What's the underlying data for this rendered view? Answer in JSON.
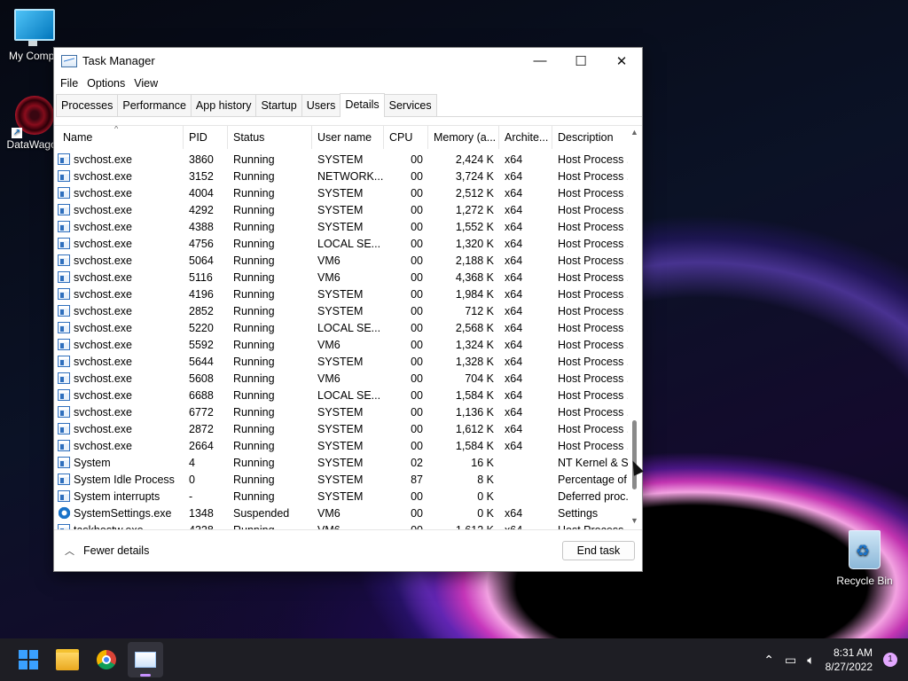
{
  "desktop": {
    "icons": [
      {
        "label": "My Compu",
        "icon": "monitor-icon"
      },
      {
        "label": "DataWagon",
        "icon": "datawagon-shortcut-icon"
      },
      {
        "label": "Recycle Bin",
        "icon": "recycle-bin-icon"
      }
    ]
  },
  "window": {
    "title": "Task Manager",
    "controls": {
      "minimize": "—",
      "maximize": "☐",
      "close": "✕"
    },
    "menu": [
      "File",
      "Options",
      "View"
    ],
    "tabs": [
      "Processes",
      "Performance",
      "App history",
      "Startup",
      "Users",
      "Details",
      "Services"
    ],
    "active_tab": "Details",
    "columns": [
      "Name",
      "PID",
      "Status",
      "User name",
      "CPU",
      "Memory (a...",
      "Archite...",
      "Description"
    ],
    "rows": [
      {
        "name": "svchost.exe",
        "pid": "3860",
        "status": "Running",
        "user": "SYSTEM",
        "cpu": "00",
        "mem": "2,424 K",
        "arch": "x64",
        "desc": "Host Process ...",
        "icon": "process"
      },
      {
        "name": "svchost.exe",
        "pid": "3152",
        "status": "Running",
        "user": "NETWORK...",
        "cpu": "00",
        "mem": "3,724 K",
        "arch": "x64",
        "desc": "Host Process ...",
        "icon": "process"
      },
      {
        "name": "svchost.exe",
        "pid": "4004",
        "status": "Running",
        "user": "SYSTEM",
        "cpu": "00",
        "mem": "2,512 K",
        "arch": "x64",
        "desc": "Host Process ...",
        "icon": "process"
      },
      {
        "name": "svchost.exe",
        "pid": "4292",
        "status": "Running",
        "user": "SYSTEM",
        "cpu": "00",
        "mem": "1,272 K",
        "arch": "x64",
        "desc": "Host Process ...",
        "icon": "process"
      },
      {
        "name": "svchost.exe",
        "pid": "4388",
        "status": "Running",
        "user": "SYSTEM",
        "cpu": "00",
        "mem": "1,552 K",
        "arch": "x64",
        "desc": "Host Process ...",
        "icon": "process"
      },
      {
        "name": "svchost.exe",
        "pid": "4756",
        "status": "Running",
        "user": "LOCAL SE...",
        "cpu": "00",
        "mem": "1,320 K",
        "arch": "x64",
        "desc": "Host Process ...",
        "icon": "process"
      },
      {
        "name": "svchost.exe",
        "pid": "5064",
        "status": "Running",
        "user": "VM6",
        "cpu": "00",
        "mem": "2,188 K",
        "arch": "x64",
        "desc": "Host Process ...",
        "icon": "process"
      },
      {
        "name": "svchost.exe",
        "pid": "5116",
        "status": "Running",
        "user": "VM6",
        "cpu": "00",
        "mem": "4,368 K",
        "arch": "x64",
        "desc": "Host Process ...",
        "icon": "process"
      },
      {
        "name": "svchost.exe",
        "pid": "4196",
        "status": "Running",
        "user": "SYSTEM",
        "cpu": "00",
        "mem": "1,984 K",
        "arch": "x64",
        "desc": "Host Process ...",
        "icon": "process"
      },
      {
        "name": "svchost.exe",
        "pid": "2852",
        "status": "Running",
        "user": "SYSTEM",
        "cpu": "00",
        "mem": "712 K",
        "arch": "x64",
        "desc": "Host Process ...",
        "icon": "process"
      },
      {
        "name": "svchost.exe",
        "pid": "5220",
        "status": "Running",
        "user": "LOCAL SE...",
        "cpu": "00",
        "mem": "2,568 K",
        "arch": "x64",
        "desc": "Host Process ...",
        "icon": "process"
      },
      {
        "name": "svchost.exe",
        "pid": "5592",
        "status": "Running",
        "user": "VM6",
        "cpu": "00",
        "mem": "1,324 K",
        "arch": "x64",
        "desc": "Host Process ...",
        "icon": "process"
      },
      {
        "name": "svchost.exe",
        "pid": "5644",
        "status": "Running",
        "user": "SYSTEM",
        "cpu": "00",
        "mem": "1,328 K",
        "arch": "x64",
        "desc": "Host Process ...",
        "icon": "process"
      },
      {
        "name": "svchost.exe",
        "pid": "5608",
        "status": "Running",
        "user": "VM6",
        "cpu": "00",
        "mem": "704 K",
        "arch": "x64",
        "desc": "Host Process ...",
        "icon": "process"
      },
      {
        "name": "svchost.exe",
        "pid": "6688",
        "status": "Running",
        "user": "LOCAL SE...",
        "cpu": "00",
        "mem": "1,584 K",
        "arch": "x64",
        "desc": "Host Process ...",
        "icon": "process"
      },
      {
        "name": "svchost.exe",
        "pid": "6772",
        "status": "Running",
        "user": "SYSTEM",
        "cpu": "00",
        "mem": "1,136 K",
        "arch": "x64",
        "desc": "Host Process ...",
        "icon": "process"
      },
      {
        "name": "svchost.exe",
        "pid": "2872",
        "status": "Running",
        "user": "SYSTEM",
        "cpu": "00",
        "mem": "1,612 K",
        "arch": "x64",
        "desc": "Host Process ...",
        "icon": "process"
      },
      {
        "name": "svchost.exe",
        "pid": "2664",
        "status": "Running",
        "user": "SYSTEM",
        "cpu": "00",
        "mem": "1,584 K",
        "arch": "x64",
        "desc": "Host Process ...",
        "icon": "process"
      },
      {
        "name": "System",
        "pid": "4",
        "status": "Running",
        "user": "SYSTEM",
        "cpu": "02",
        "mem": "16 K",
        "arch": "",
        "desc": "NT Kernel & S...",
        "icon": "process"
      },
      {
        "name": "System Idle Process",
        "pid": "0",
        "status": "Running",
        "user": "SYSTEM",
        "cpu": "87",
        "mem": "8 K",
        "arch": "",
        "desc": "Percentage of...",
        "icon": "process"
      },
      {
        "name": "System interrupts",
        "pid": "-",
        "status": "Running",
        "user": "SYSTEM",
        "cpu": "00",
        "mem": "0 K",
        "arch": "",
        "desc": "Deferred proc...",
        "icon": "process"
      },
      {
        "name": "SystemSettings.exe",
        "pid": "1348",
        "status": "Suspended",
        "user": "VM6",
        "cpu": "00",
        "mem": "0 K",
        "arch": "x64",
        "desc": "Settings",
        "icon": "gear"
      },
      {
        "name": "taskhostw.exe",
        "pid": "4328",
        "status": "Running",
        "user": "VM6",
        "cpu": "00",
        "mem": "1,612 K",
        "arch": "x64",
        "desc": "Host Process ...",
        "icon": "process"
      }
    ],
    "footer": {
      "fewer_details": "Fewer details",
      "end_task": "End task"
    }
  },
  "taskbar": {
    "apps": [
      "start-button",
      "file-explorer",
      "chrome",
      "task-manager"
    ],
    "active_app": "task-manager",
    "clock": {
      "time": "8:31 AM",
      "date": "8/27/2022"
    },
    "notification_count": "1"
  }
}
